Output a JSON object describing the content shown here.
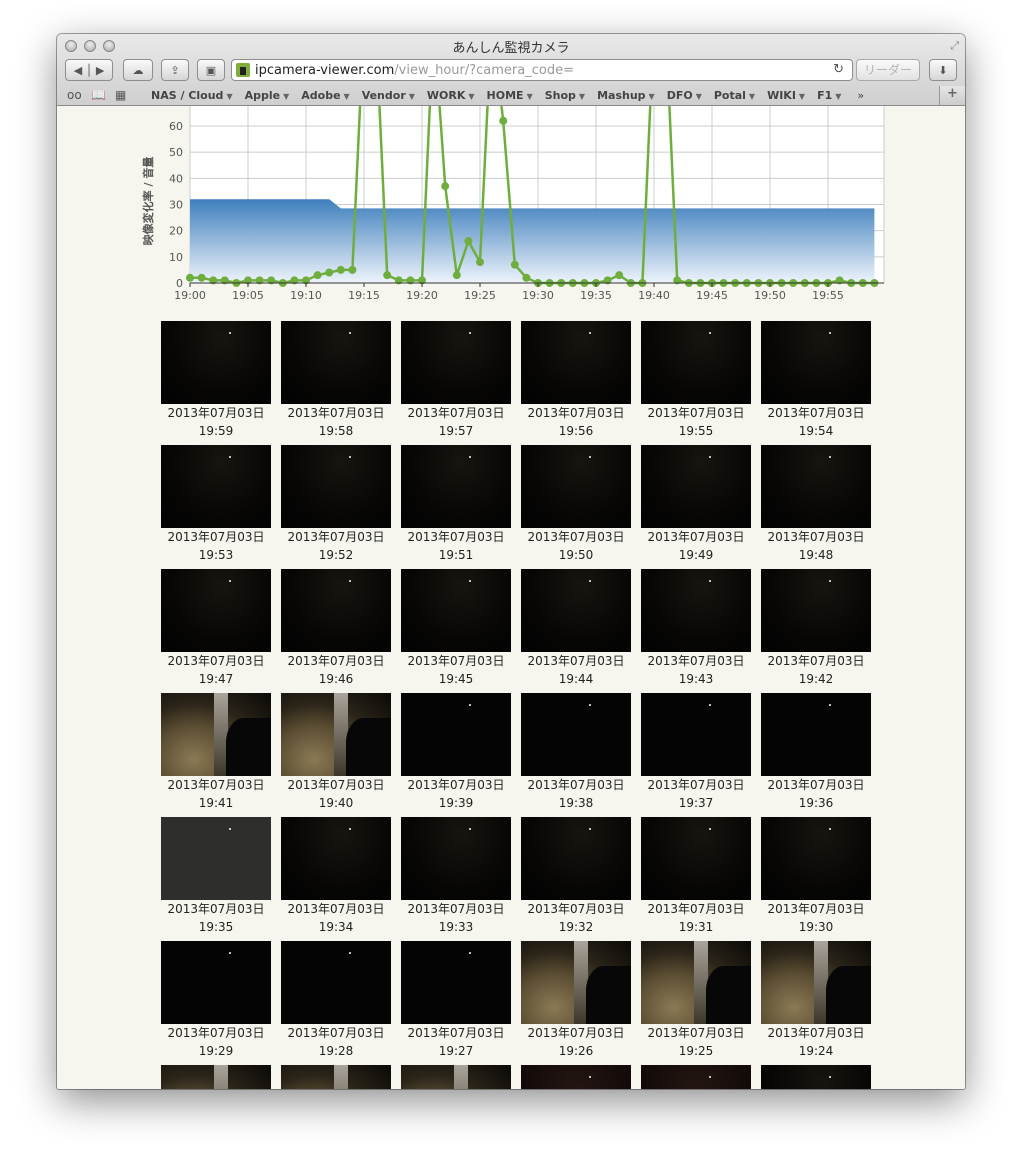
{
  "window": {
    "title": "あんしん監視カメラ"
  },
  "toolbar": {
    "url_domain": "ipcamera-viewer.com",
    "url_path": "/view_hour/?camera_code=",
    "reader_label": "リーダー"
  },
  "bookmarks": [
    "NAS / Cloud",
    "Apple",
    "Adobe",
    "Vendor",
    "WORK",
    "HOME",
    "Shop",
    "Mashup",
    "DFO",
    "Potal",
    "WIKI",
    "F1"
  ],
  "chart_data": {
    "type": "line",
    "ylabel": "映像変化率 / 音量",
    "yticks": [
      "0",
      "10",
      "20",
      "30",
      "40",
      "50",
      "60"
    ],
    "xticks": [
      "19:00",
      "19:05",
      "19:10",
      "19:15",
      "19:20",
      "19:25",
      "19:30",
      "19:35",
      "19:40",
      "19:45",
      "19:50",
      "19:55"
    ],
    "ylim": [
      0,
      67
    ],
    "series": [
      {
        "name": "映像変化率",
        "type": "line",
        "color": "#6fae3e",
        "x_minutes": "19:00-19:59",
        "values": [
          2,
          2,
          1,
          1,
          0,
          1,
          1,
          1,
          0,
          1,
          1,
          3,
          4,
          5,
          5,
          100,
          100,
          3,
          1,
          1,
          1,
          100,
          37,
          3,
          16,
          8,
          100,
          62,
          7,
          2,
          0,
          0,
          0,
          0,
          0,
          0,
          1,
          3,
          0,
          0,
          100,
          100,
          1,
          0,
          0,
          0,
          0,
          0,
          0,
          0,
          0,
          0,
          0,
          0,
          0,
          0,
          1,
          0,
          0,
          0
        ]
      },
      {
        "name": "音量",
        "type": "area",
        "color": "#4a88c4",
        "values": [
          32,
          32,
          32,
          32,
          32,
          32,
          32,
          32,
          32,
          32,
          32,
          32,
          32,
          28.5,
          28.5,
          28.5,
          28.5,
          28.5,
          28.5,
          28.5,
          28.5,
          28.5,
          28.5,
          28.5,
          28.5,
          28.5,
          28.5,
          28.5,
          28.5,
          28.5,
          28.5,
          28.5,
          28.5,
          28.5,
          28.5,
          28.5,
          28.5,
          28.5,
          28.5,
          28.5,
          28.5,
          28.5,
          28.5,
          28.5,
          28.5,
          28.5,
          28.5,
          28.5,
          28.5,
          28.5,
          28.5,
          28.5,
          28.5,
          28.5,
          28.5,
          28.5,
          28.5,
          28.5,
          28.5,
          28.5
        ]
      }
    ]
  },
  "thumbnails": {
    "date": "2013年07月03日",
    "items": [
      {
        "time": "19:59",
        "tone": "dim"
      },
      {
        "time": "19:58",
        "tone": "dim"
      },
      {
        "time": "19:57",
        "tone": "dim"
      },
      {
        "time": "19:56",
        "tone": "dim"
      },
      {
        "time": "19:55",
        "tone": "dim"
      },
      {
        "time": "19:54",
        "tone": "dim"
      },
      {
        "time": "19:53",
        "tone": "dim"
      },
      {
        "time": "19:52",
        "tone": "dim"
      },
      {
        "time": "19:51",
        "tone": "dim"
      },
      {
        "time": "19:50",
        "tone": "dim"
      },
      {
        "time": "19:49",
        "tone": "dim"
      },
      {
        "time": "19:48",
        "tone": "dim"
      },
      {
        "time": "19:47",
        "tone": "dim"
      },
      {
        "time": "19:46",
        "tone": "dim"
      },
      {
        "time": "19:45",
        "tone": "dim"
      },
      {
        "time": "19:44",
        "tone": "dim"
      },
      {
        "time": "19:43",
        "tone": "dim"
      },
      {
        "time": "19:42",
        "tone": "dim"
      },
      {
        "time": "19:41",
        "tone": "bright"
      },
      {
        "time": "19:40",
        "tone": "bright"
      },
      {
        "time": "19:39",
        "tone": "dark"
      },
      {
        "time": "19:38",
        "tone": "dark"
      },
      {
        "time": "19:37",
        "tone": "dark"
      },
      {
        "time": "19:36",
        "tone": "dark"
      },
      {
        "time": "19:35",
        "tone": "gray"
      },
      {
        "time": "19:34",
        "tone": "dim"
      },
      {
        "time": "19:33",
        "tone": "dim"
      },
      {
        "time": "19:32",
        "tone": "dim"
      },
      {
        "time": "19:31",
        "tone": "dim"
      },
      {
        "time": "19:30",
        "tone": "dim"
      },
      {
        "time": "19:29",
        "tone": "dark"
      },
      {
        "time": "19:28",
        "tone": "dark"
      },
      {
        "time": "19:27",
        "tone": "dark"
      },
      {
        "time": "19:26",
        "tone": "bright"
      },
      {
        "time": "19:25",
        "tone": "bright"
      },
      {
        "time": "19:24",
        "tone": "bright"
      },
      {
        "tone": "bright"
      },
      {
        "tone": "bright"
      },
      {
        "tone": "bright"
      },
      {
        "tone": "red"
      },
      {
        "tone": "red"
      },
      {
        "tone": "dim"
      }
    ]
  }
}
